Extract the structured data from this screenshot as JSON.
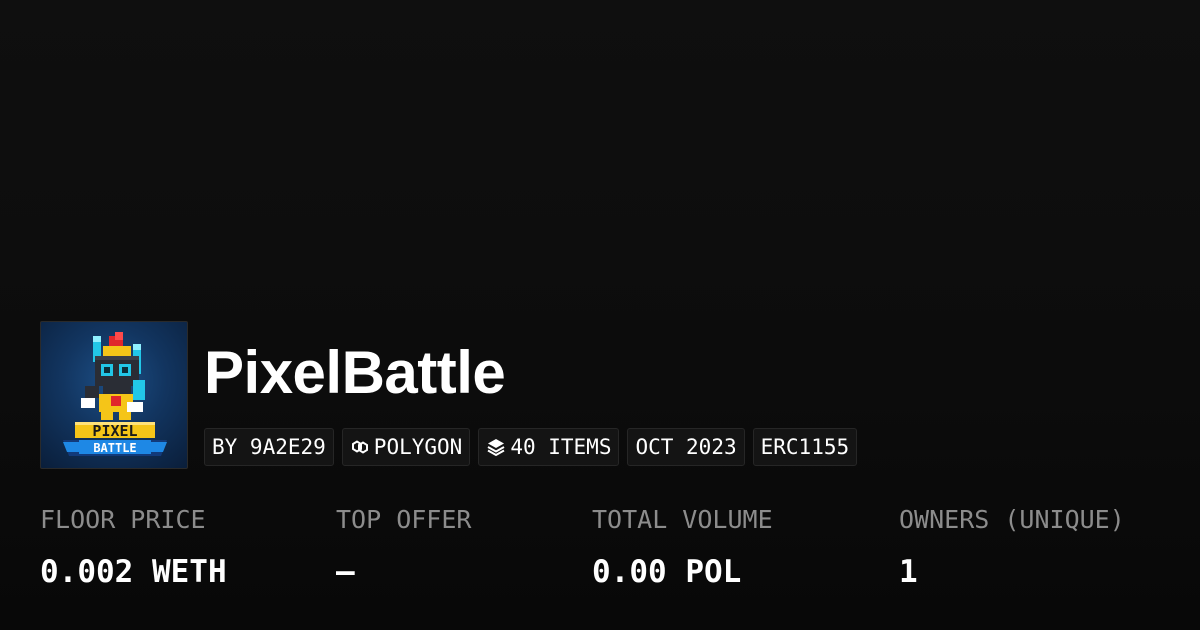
{
  "collection": {
    "title": "PixelBattle",
    "avatar_icon": "pixelbattle-logo-icon",
    "avatar_text": "PIXEL BATTLE"
  },
  "tags": {
    "creator": "BY 9A2E29",
    "chain": "POLYGON",
    "chain_icon": "polygon-chain-icon",
    "items": "40 ITEMS",
    "items_icon": "layers-stack-icon",
    "date": "OCT 2023",
    "standard": "ERC1155"
  },
  "stats": [
    {
      "label": "FLOOR PRICE",
      "value": "0.002 WETH"
    },
    {
      "label": "TOP OFFER",
      "value": "–"
    },
    {
      "label": "TOTAL VOLUME",
      "value": "0.00 POL"
    },
    {
      "label": "OWNERS (UNIQUE)",
      "value": "1"
    }
  ],
  "colors": {
    "background": "#0c0c0c",
    "text": "#ffffff",
    "muted": "#8c8c8c",
    "tag_bg": "#141414",
    "tag_border": "#262626"
  }
}
